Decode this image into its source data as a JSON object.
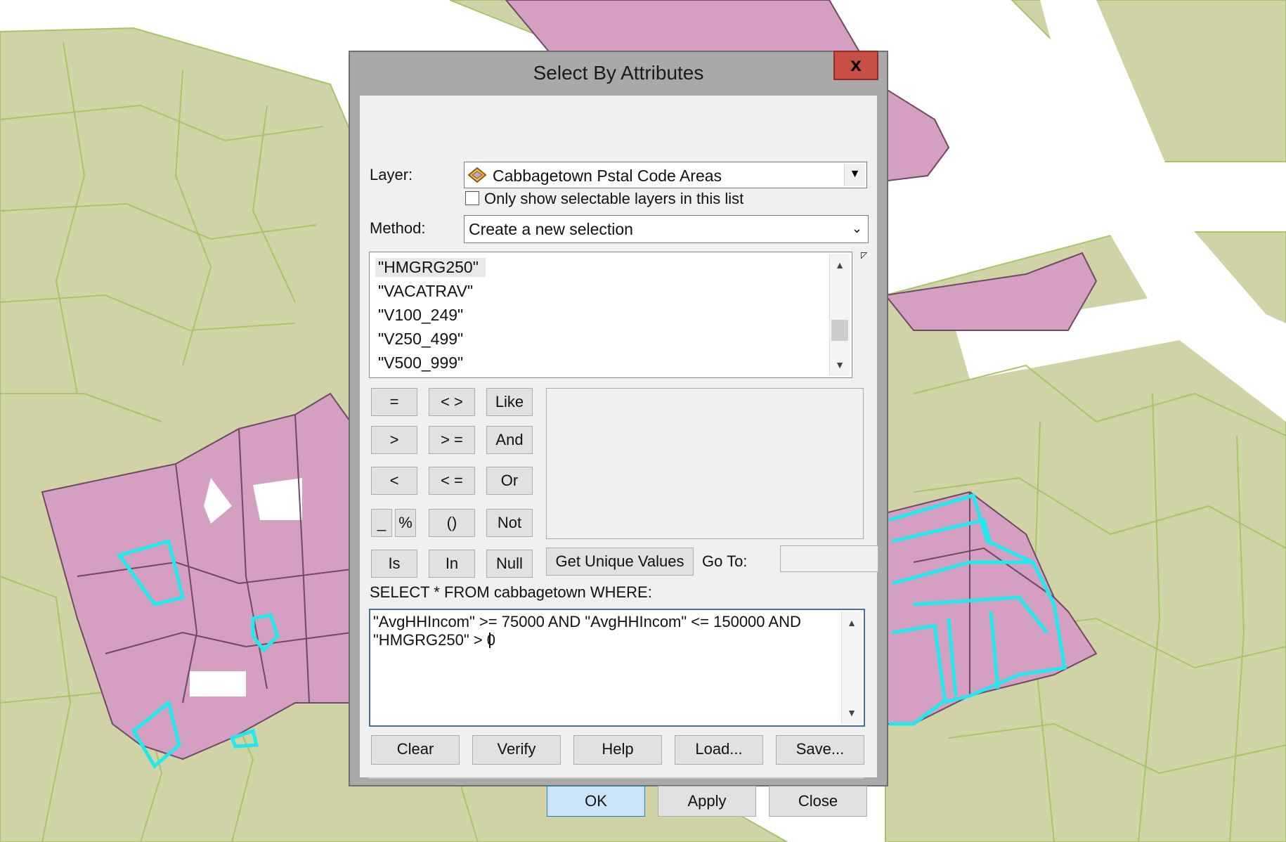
{
  "dialog": {
    "title": "Select By Attributes",
    "close_label": "x",
    "layer_label": "Layer:",
    "layer_value": "Cabbagetown Pstal Code Areas",
    "only_selectable_label": "Only show selectable layers in this list",
    "only_selectable_checked": false,
    "method_label": "Method:",
    "method_value": "Create a new selection",
    "fields": [
      "\"HMGRG250\"",
      "\"VACATRAV\"",
      "\"V100_249\"",
      "\"V250_499\"",
      "\"V500_999\""
    ],
    "selected_field": "\"HMGRG250\"",
    "operators": {
      "eq": "=",
      "ne": "< >",
      "like": "Like",
      "gt": ">",
      "ge": "> =",
      "and": "And",
      "lt": "<",
      "le": "< =",
      "or": "Or",
      "underscore": "_",
      "percent": "%",
      "parens": "()",
      "not": "Not",
      "is": "Is",
      "in": "In",
      "null": "Null"
    },
    "get_unique_values": "Get Unique Values",
    "goto_label": "Go To:",
    "goto_value": "",
    "sql_prefix": "SELECT * FROM cabbagetown WHERE:",
    "expression": "\"AvgHHIncom\" >= 75000 AND \"AvgHHIncom\" <= 150000 AND \"HMGRG250\" > 0",
    "buttons": {
      "clear": "Clear",
      "verify": "Verify",
      "help": "Help",
      "load": "Load...",
      "save": "Save...",
      "ok": "OK",
      "apply": "Apply",
      "close": "Close"
    }
  },
  "map": {
    "colors": {
      "background": "#ffffff",
      "tract_fill": "#cfd3a5",
      "tract_stroke": "#a8c46a",
      "selectable_fill": "#d49fc1",
      "selectable_stroke": "#6e4a63",
      "selection_outline": "#22e8ee"
    }
  }
}
